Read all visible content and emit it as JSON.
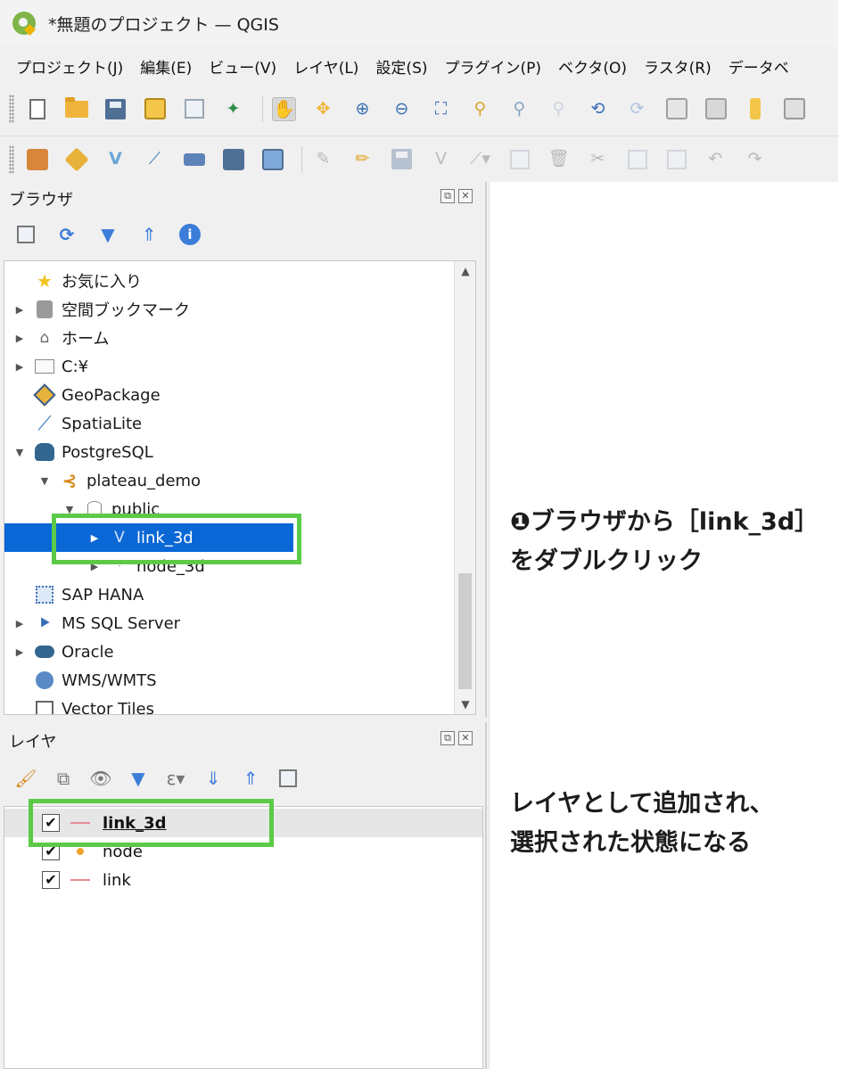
{
  "window": {
    "title": "*無題のプロジェクト — QGIS"
  },
  "menu": [
    "プロジェクト(J)",
    "編集(E)",
    "ビュー(V)",
    "レイヤ(L)",
    "設定(S)",
    "プラグイン(P)",
    "ベクタ(O)",
    "ラスタ(R)",
    "データベ"
  ],
  "colors": {
    "selection": "#0a67d6",
    "highlight": "#5cca46",
    "line_symbol": "#e98b96",
    "point_symbol": "#f0a32d",
    "qgis_green": "#7fb548"
  },
  "browser": {
    "title": "ブラウザ",
    "buttons": {
      "float": "⧉",
      "close": "✕"
    },
    "tools": [
      "add-selected-icon",
      "refresh-icon",
      "filter-icon",
      "collapse-all-icon",
      "info-icon"
    ],
    "items": [
      {
        "label": "お気に入り",
        "icon": "star-icon"
      },
      {
        "label": "空間ブックマーク",
        "icon": "bookmark-icon"
      },
      {
        "label": "ホーム",
        "icon": "home-folder-icon"
      },
      {
        "label": "C:¥",
        "icon": "folder-icon"
      },
      {
        "label": "GeoPackage",
        "icon": "geopackage-icon"
      },
      {
        "label": "SpatiaLite",
        "icon": "spatialite-icon"
      },
      {
        "label": "PostgreSQL",
        "icon": "postgresql-icon"
      },
      {
        "label": "plateau_demo",
        "icon": "connection-icon"
      },
      {
        "label": "public",
        "icon": "schema-icon"
      },
      {
        "label": "link_3d",
        "icon": "line-layer-icon"
      },
      {
        "label": "node_3d",
        "icon": "point-layer-icon"
      },
      {
        "label": "SAP HANA",
        "icon": "sap-hana-icon"
      },
      {
        "label": "MS SQL Server",
        "icon": "mssql-icon"
      },
      {
        "label": "Oracle",
        "icon": "oracle-icon"
      },
      {
        "label": "WMS/WMTS",
        "icon": "wms-icon"
      },
      {
        "label": "Vector Tiles",
        "icon": "vector-tiles-icon"
      }
    ]
  },
  "layers": {
    "title": "レイヤ",
    "buttons": {
      "float": "⧉",
      "close": "✕"
    },
    "items": [
      {
        "label": "link_3d",
        "checked": "✔",
        "symbol": "line"
      },
      {
        "label": "node",
        "checked": "✔",
        "symbol": "point"
      },
      {
        "label": "link",
        "checked": "✔",
        "symbol": "line"
      }
    ]
  },
  "annotations": {
    "step1_line1": "❶ブラウザから［link_3d］",
    "step1_line2": "をダブルクリック",
    "step2_line1": "レイヤとして追加され、",
    "step2_line2": "選択された状態になる"
  }
}
